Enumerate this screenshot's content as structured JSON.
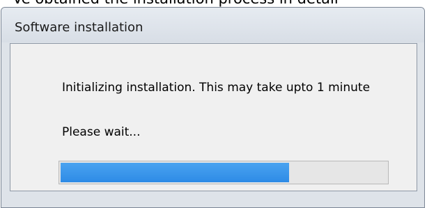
{
  "background_text": "Ve obtained the installation process in detail",
  "window": {
    "title": "Software installation"
  },
  "dialog": {
    "message": "Initializing installation. This may take upto 1 minute",
    "wait_text": "Please wait...",
    "progress_fraction": 0.7,
    "progress_color": "#3292ea"
  }
}
